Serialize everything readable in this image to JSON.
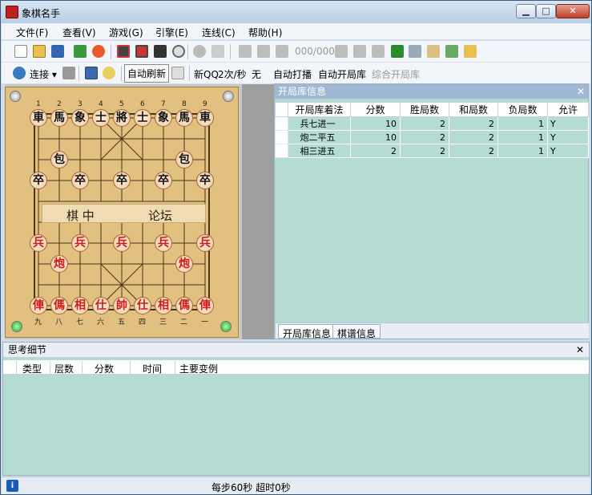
{
  "window": {
    "title": "象棋名手",
    "controls": {
      "min": "▁",
      "max": "□",
      "close": "✕"
    }
  },
  "menu": [
    "文件(F)",
    "查看(V)",
    "游戏(G)",
    "引擎(E)",
    "连线(C)",
    "帮助(H)"
  ],
  "toolbar1": {
    "move_counter": "000/000"
  },
  "toolbar2": {
    "connect": "连接 ▾",
    "auto_refresh": "自动刷新",
    "new_qq": "新QQ",
    "speed": "2次/秒",
    "none": "无",
    "auto_play": "自动打播",
    "auto_opening": "自动开局库",
    "combined_opening": "综合开局库"
  },
  "board": {
    "top_numbers": [
      "1",
      "2",
      "3",
      "4",
      "5",
      "6",
      "7",
      "8",
      "9"
    ],
    "bottom_numbers": [
      "九",
      "八",
      "七",
      "六",
      "五",
      "四",
      "三",
      "二",
      "一"
    ],
    "river_left": "棋  中",
    "river_right": "论坛",
    "black_back": [
      "車",
      "馬",
      "象",
      "士",
      "將",
      "士",
      "象",
      "馬",
      "車"
    ],
    "black_cannon": "包",
    "black_pawn": "卒",
    "red_pawn": "兵",
    "red_cannon": "炮",
    "red_back": [
      "俥",
      "傌",
      "相",
      "仕",
      "帥",
      "仕",
      "相",
      "傌",
      "俥"
    ]
  },
  "opening_panel": {
    "title": "开局库信息",
    "close": "✕",
    "columns": [
      "开局库着法",
      "分数",
      "胜局数",
      "和局数",
      "负局数",
      "允许"
    ],
    "rows": [
      [
        "兵七进一",
        "10",
        "2",
        "2",
        "1",
        "Y"
      ],
      [
        "炮二平五",
        "10",
        "2",
        "2",
        "1",
        "Y"
      ],
      [
        "相三进五",
        "2",
        "2",
        "2",
        "1",
        "Y"
      ]
    ],
    "tabs": [
      "开局库信息",
      "棋谱信息"
    ]
  },
  "thinking_panel": {
    "title": "思考细节",
    "close": "✕",
    "columns": [
      "类型",
      "层数",
      "分数",
      "时间",
      "主要变例"
    ]
  },
  "status": {
    "icon": "i",
    "text": "每步60秒 超时0秒"
  }
}
